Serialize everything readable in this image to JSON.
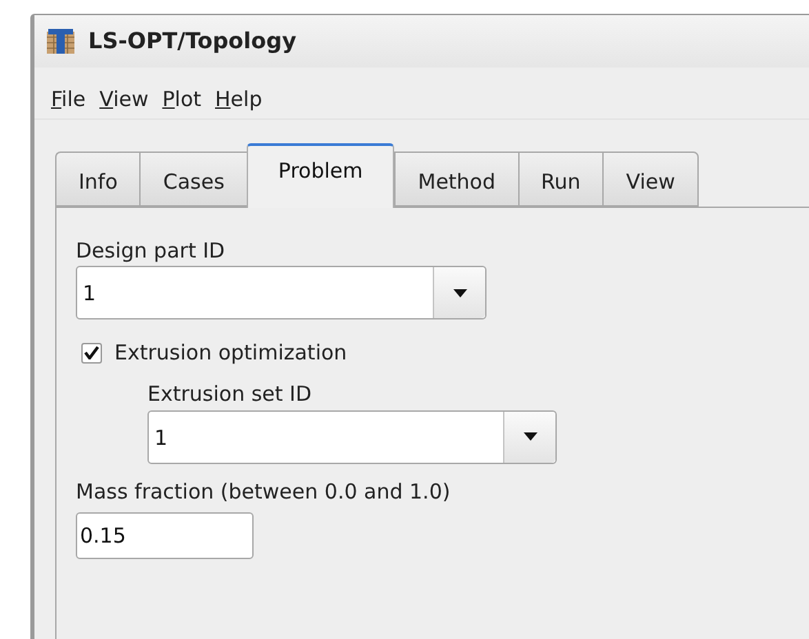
{
  "window": {
    "title": "LS-OPT/Topology"
  },
  "menu": [
    "File",
    "View",
    "Plot",
    "Help"
  ],
  "tabs": [
    {
      "label": "Info",
      "selected": false
    },
    {
      "label": "Cases",
      "selected": false
    },
    {
      "label": "Problem",
      "selected": true
    },
    {
      "label": "Method",
      "selected": false
    },
    {
      "label": "Run",
      "selected": false
    },
    {
      "label": "View",
      "selected": false
    }
  ],
  "design_part": {
    "label": "Design part ID",
    "value": "1"
  },
  "extrusion": {
    "label": "Extrusion optimization",
    "checked": true,
    "set_label": "Extrusion set ID",
    "set_value": "1"
  },
  "mass_fraction": {
    "label": "Mass fraction (between 0.0 and 1.0)",
    "value": "0.15"
  }
}
